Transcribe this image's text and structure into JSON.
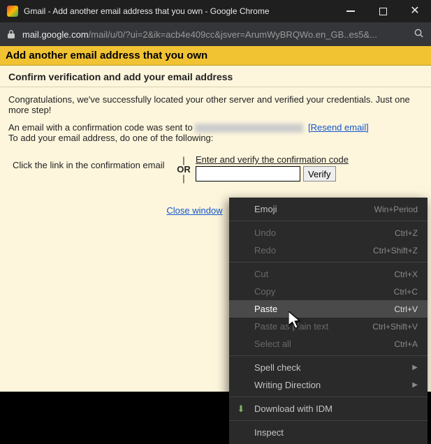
{
  "titlebar": {
    "text": "Gmail - Add another email address that you own - Google Chrome"
  },
  "addressbar": {
    "host": "mail.google.com",
    "path": "/mail/u/0/?ui=2&ik=acb4e409cc&jsver=ArumWyBRQWo.en_GB..es5&..."
  },
  "page": {
    "header": "Add another email address that you own",
    "subheader": "Confirm verification and add your email address",
    "congrats": "Congratulations, we've successfully located your other server and verified your credentials. Just one more step!",
    "sent_prefix": "An email with a confirmation code was sent to ",
    "resend_label": "[Resend email]",
    "instructions_line2": "To add your email address, do one of the following:",
    "left_option": "Click the link in the confirmation email",
    "or": "OR",
    "code_label": "Enter and verify the confirmation code",
    "verify_btn": "Verify",
    "close": "Close window"
  },
  "ctx": {
    "emoji": "Emoji",
    "emoji_k": "Win+Period",
    "undo": "Undo",
    "undo_k": "Ctrl+Z",
    "redo": "Redo",
    "redo_k": "Ctrl+Shift+Z",
    "cut": "Cut",
    "cut_k": "Ctrl+X",
    "copy": "Copy",
    "copy_k": "Ctrl+C",
    "paste": "Paste",
    "paste_k": "Ctrl+V",
    "paste_plain": "Paste as plain text",
    "paste_plain_k": "Ctrl+Shift+V",
    "selectall": "Select all",
    "selectall_k": "Ctrl+A",
    "spell": "Spell check",
    "writing": "Writing Direction",
    "idm": "Download with IDM",
    "inspect": "Inspect"
  }
}
